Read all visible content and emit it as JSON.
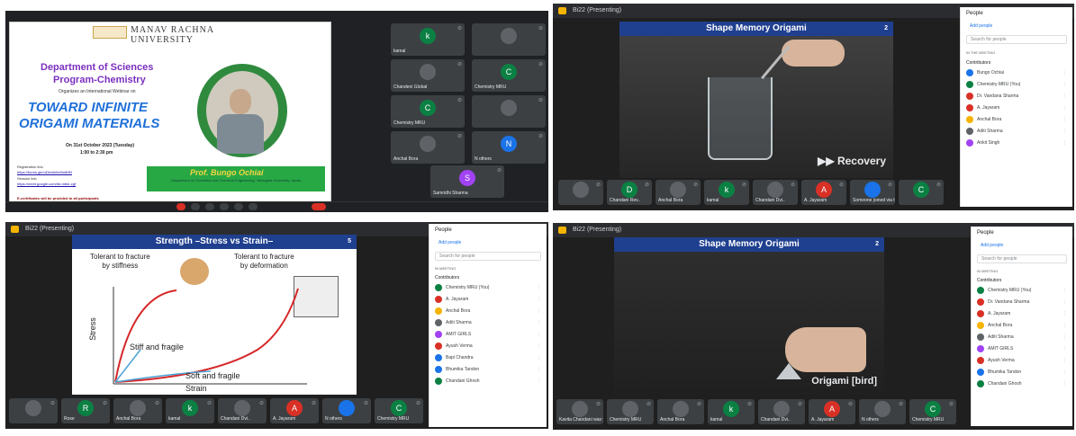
{
  "q1": {
    "university_name": "MANAV RACHNA",
    "university_name2": "UNIVERSITY",
    "department": "Department of Sciences",
    "program": "Program-Chemistry",
    "organizes": "Organizes an International Webinar on",
    "title1": "TOWARD INFINITE",
    "title2": "ORIGAMI MATERIALS",
    "date": "On 31st October 2023 (Tuesday)",
    "time": "1:00 to 2:30 pm",
    "reg_label": "Registration link:",
    "reg_url": "https://forms.gle/uDbxhMxt9m8HB",
    "session_label": "Session link:",
    "session_url": "https://meet.google.com/rkt-mbkr-cgf",
    "certificate_note": "E-certificates will be provided to all participants",
    "speaker_name": "Prof. Bungo Ochiai",
    "speaker_role": "Department of Chemistry and Chemical Engineering, Yamagata University, Japan",
    "tiles": [
      {
        "initial": "k",
        "name": "kamal",
        "color": "#0b8043"
      },
      {
        "initial": "",
        "name": "",
        "color": "#5f6368"
      },
      {
        "initial": "",
        "name": "Chandeni Global",
        "color": "#5f6368"
      },
      {
        "initial": "C",
        "name": "Chemistry MRU",
        "color": "#0b8043"
      },
      {
        "initial": "C",
        "name": "Chemistry MRU",
        "color": "#0b8043"
      },
      {
        "initial": "",
        "name": "",
        "color": "#5f6368"
      },
      {
        "initial": "",
        "name": "Anchal Bora",
        "color": "#5f6368"
      },
      {
        "initial": "N",
        "name": "N others",
        "color": "#1a73e8"
      },
      {
        "initial": "S",
        "name": "Samridhi Sharma",
        "color": "#a142f4"
      }
    ]
  },
  "q2": {
    "topbar": "Bi22 (Presenting)",
    "slide_title": "Shape Memory Origami",
    "slide_page": "2",
    "overlay": "▶▶ Recovery",
    "tiles": [
      {
        "initial": "",
        "name": "",
        "color": "#5f6368"
      },
      {
        "initial": "D",
        "name": "Chandani Rev..",
        "color": "#0b8043"
      },
      {
        "initial": "",
        "name": "Anchal Bora",
        "color": "#5f6368"
      },
      {
        "initial": "k",
        "name": "kamal",
        "color": "#0b8043"
      },
      {
        "initial": "",
        "name": "Chandani Dvi..",
        "color": "#5f6368"
      },
      {
        "initial": "A",
        "name": "A. Jayaram",
        "color": "#d93025"
      },
      {
        "initial": "",
        "name": "Someone joined via the call",
        "color": "#1a73e8"
      },
      {
        "initial": "C",
        "name": "",
        "color": "#0b8043"
      }
    ],
    "people": {
      "header": "People",
      "add": "Add people",
      "search": "Search for people",
      "section1": "IN THE MEETING",
      "section2": "Contributors",
      "rows": [
        {
          "name": "Bungo Ochiai",
          "color": "#1a73e8"
        },
        {
          "name": "Chemistry MRU (You)",
          "color": "#0b8043"
        },
        {
          "name": "Dr. Vandana Sharma",
          "color": "#d93025"
        },
        {
          "name": "A. Jayaram",
          "color": "#d93025"
        },
        {
          "name": "Anchal Bora",
          "color": "#f4b400"
        },
        {
          "name": "Aditi Sharma",
          "color": "#5f6368"
        },
        {
          "name": "Ankit Singh",
          "color": "#a142f4"
        }
      ]
    }
  },
  "q3": {
    "topbar": "Bi22 (Presenting)",
    "slide_title": "Strength –Stress vs Strain–",
    "slide_page": "5",
    "label_tol_stiff": "Tolerant to fracture\nby stiffness",
    "label_tol_def": "Tolerant to fracture\nby deformation",
    "label_stiff_fragile": "Stiff and fragile",
    "label_soft_fragile": "Soft and fragile",
    "axis_y": "Stress",
    "axis_x": "Strain",
    "tiles": [
      {
        "initial": "",
        "name": "",
        "color": "#5f6368"
      },
      {
        "initial": "R",
        "name": "Rose",
        "color": "#0b8043"
      },
      {
        "initial": "",
        "name": "Anchal Bora",
        "color": "#5f6368"
      },
      {
        "initial": "k",
        "name": "kamal",
        "color": "#0b8043"
      },
      {
        "initial": "",
        "name": "Chandani Dvi..",
        "color": "#5f6368"
      },
      {
        "initial": "A",
        "name": "A. Jayaram",
        "color": "#d93025"
      },
      {
        "initial": "",
        "name": "N others",
        "color": "#1a73e8"
      },
      {
        "initial": "C",
        "name": "Chemistry MRU",
        "color": "#0b8043"
      }
    ],
    "people": {
      "header": "People",
      "add": "Add people",
      "search": "Search for people",
      "section1": "IN MEETING",
      "section2": "Contributors",
      "rows": [
        {
          "name": "Chemistry MRU (You)",
          "color": "#0b8043"
        },
        {
          "name": "A. Jayaram",
          "color": "#d93025"
        },
        {
          "name": "Anchal Bora",
          "color": "#f4b400"
        },
        {
          "name": "Aditi Sharma",
          "color": "#5f6368"
        },
        {
          "name": "AMIT GIRLS",
          "color": "#a142f4"
        },
        {
          "name": "Ayush Verma",
          "color": "#d93025"
        },
        {
          "name": "Bapi Chandra",
          "color": "#1a73e8"
        },
        {
          "name": "Bhumika Tandon",
          "color": "#1a73e8"
        },
        {
          "name": "Chandani Ghosh",
          "color": "#0b8043"
        }
      ]
    }
  },
  "q4": {
    "topbar": "Bi22 (Presenting)",
    "slide_title": "Shape Memory Origami",
    "slide_page": "2",
    "overlay": "Origami [bird]",
    "tiles": [
      {
        "initial": "",
        "name": "Kavita Chandani was your film meeting",
        "color": "#5f6368"
      },
      {
        "initial": "",
        "name": "Chemistry MRU",
        "color": "#5f6368"
      },
      {
        "initial": "",
        "name": "Anchal Bora",
        "color": "#5f6368"
      },
      {
        "initial": "k",
        "name": "kamal",
        "color": "#0b8043"
      },
      {
        "initial": "",
        "name": "Chandani Dvi..",
        "color": "#5f6368"
      },
      {
        "initial": "A",
        "name": "A. Jayaram",
        "color": "#d93025"
      },
      {
        "initial": "",
        "name": "N others",
        "color": "#5f6368"
      },
      {
        "initial": "C",
        "name": "Chemistry MRU",
        "color": "#0b8043"
      }
    ],
    "people": {
      "header": "People",
      "add": "Add people",
      "search": "Search for people",
      "section1": "IN MEETING",
      "section2": "Contributors",
      "rows": [
        {
          "name": "Chemistry MRU (You)",
          "color": "#0b8043"
        },
        {
          "name": "Dr. Vandana Sharma",
          "color": "#d93025"
        },
        {
          "name": "A. Jayaram",
          "color": "#d93025"
        },
        {
          "name": "Anchal Bora",
          "color": "#f4b400"
        },
        {
          "name": "Aditi Sharma",
          "color": "#5f6368"
        },
        {
          "name": "AMIT GIRLS",
          "color": "#a142f4"
        },
        {
          "name": "Ayush Verma",
          "color": "#d93025"
        },
        {
          "name": "Bhumika Tandon",
          "color": "#1a73e8"
        },
        {
          "name": "Chandani Ghosh",
          "color": "#0b8043"
        }
      ]
    }
  }
}
